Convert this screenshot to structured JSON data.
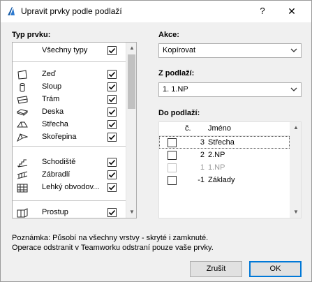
{
  "window": {
    "title": "Upravit prvky podle podlaží",
    "help": "?",
    "close": "✕"
  },
  "types": {
    "heading": "Typ prvku:",
    "all": {
      "label": "Všechny typy",
      "checked": true
    },
    "group1": [
      {
        "label": "Zeď",
        "icon": "wall-icon",
        "checked": true
      },
      {
        "label": "Sloup",
        "icon": "column-icon",
        "checked": true
      },
      {
        "label": "Trám",
        "icon": "beam-icon",
        "checked": true
      },
      {
        "label": "Deska",
        "icon": "slab-icon",
        "checked": true
      },
      {
        "label": "Střecha",
        "icon": "roof-icon",
        "checked": true
      },
      {
        "label": "Skořepina",
        "icon": "shell-icon",
        "checked": true
      }
    ],
    "group2": [
      {
        "label": "Schodiště",
        "icon": "stair-icon",
        "checked": true
      },
      {
        "label": "Zábradlí",
        "icon": "railing-icon",
        "checked": true
      },
      {
        "label": "Lehký obvodov...",
        "icon": "curtain-wall-icon",
        "checked": true
      }
    ],
    "group3": [
      {
        "label": "Prostup",
        "icon": "opening-icon",
        "checked": true
      }
    ]
  },
  "action": {
    "label": "Akce:",
    "value": "Kopírovat"
  },
  "from_story": {
    "label": "Z podlaží:",
    "value": "1. 1.NP"
  },
  "to_story": {
    "label": "Do podlaží:",
    "col_num": "č.",
    "col_name": "Jméno",
    "rows": [
      {
        "num": "3",
        "name": "Střecha",
        "checked": false,
        "disabled": false,
        "selected": true
      },
      {
        "num": "2",
        "name": "2.NP",
        "checked": false,
        "disabled": false,
        "selected": false
      },
      {
        "num": "1",
        "name": "1.NP",
        "checked": false,
        "disabled": true,
        "selected": false
      },
      {
        "num": "-1",
        "name": "Základy",
        "checked": false,
        "disabled": false,
        "selected": false
      }
    ]
  },
  "notes": {
    "line1": "Poznámka: Působí na všechny vrstvy - skryté i zamknuté.",
    "line2": "Operace odstranit v Teamworku odstraní pouze vaše prvky."
  },
  "buttons": {
    "cancel": "Zrušit",
    "ok": "OK"
  },
  "colors": {
    "accent": "#0078d7",
    "check": "#000000"
  }
}
